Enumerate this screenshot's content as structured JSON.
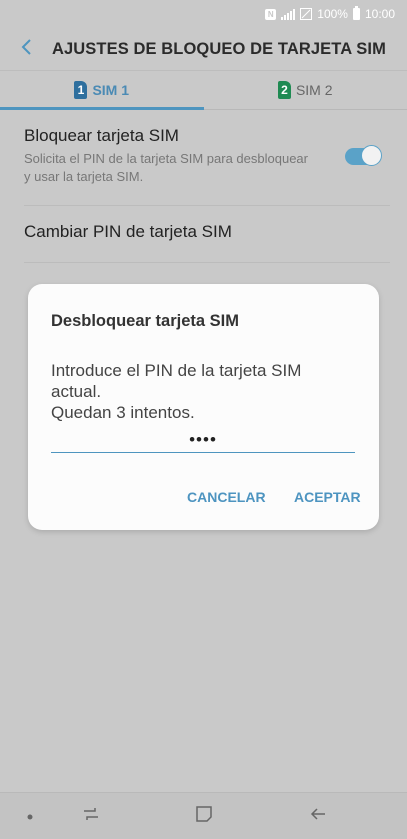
{
  "status_bar": {
    "notification_icon": "n-notification-icon",
    "signal_icon": "signal-icon",
    "sim_icon": "sim-status-icon",
    "battery_percent": "100%",
    "battery_icon": "battery-icon",
    "time": "10:00"
  },
  "header": {
    "back_icon": "chevron-left-icon",
    "title": "AJUSTES DE BLOQUEO DE TARJETA SIM"
  },
  "tabs": [
    {
      "badge": "1",
      "label": "SIM 1",
      "active": true,
      "color": "#2e6f9e"
    },
    {
      "badge": "2",
      "label": "SIM 2",
      "active": false,
      "color": "#1f8a52"
    }
  ],
  "settings": {
    "lock_sim": {
      "title": "Bloquear tarjeta SIM",
      "subtitle": "Solicita el PIN de la tarjeta SIM para desbloquear y usar la tarjeta SIM.",
      "toggle_on": true
    },
    "change_pin": {
      "title": "Cambiar PIN de tarjeta SIM"
    }
  },
  "dialog": {
    "title": "Desbloquear tarjeta SIM",
    "message_line1": "Introduce el PIN de la tarjeta SIM actual.",
    "message_line2": "Quedan 3 intentos.",
    "pin_value": "••••",
    "cancel_label": "CANCELAR",
    "accept_label": "ACEPTAR"
  },
  "nav_bar": {
    "dot_icon": "dot-icon",
    "recents_icon": "recents-icon",
    "home_icon": "home-icon",
    "back_icon": "back-arrow-icon"
  },
  "colors": {
    "accent": "#4e95bf",
    "overlay_background": "#c9c9c9"
  }
}
